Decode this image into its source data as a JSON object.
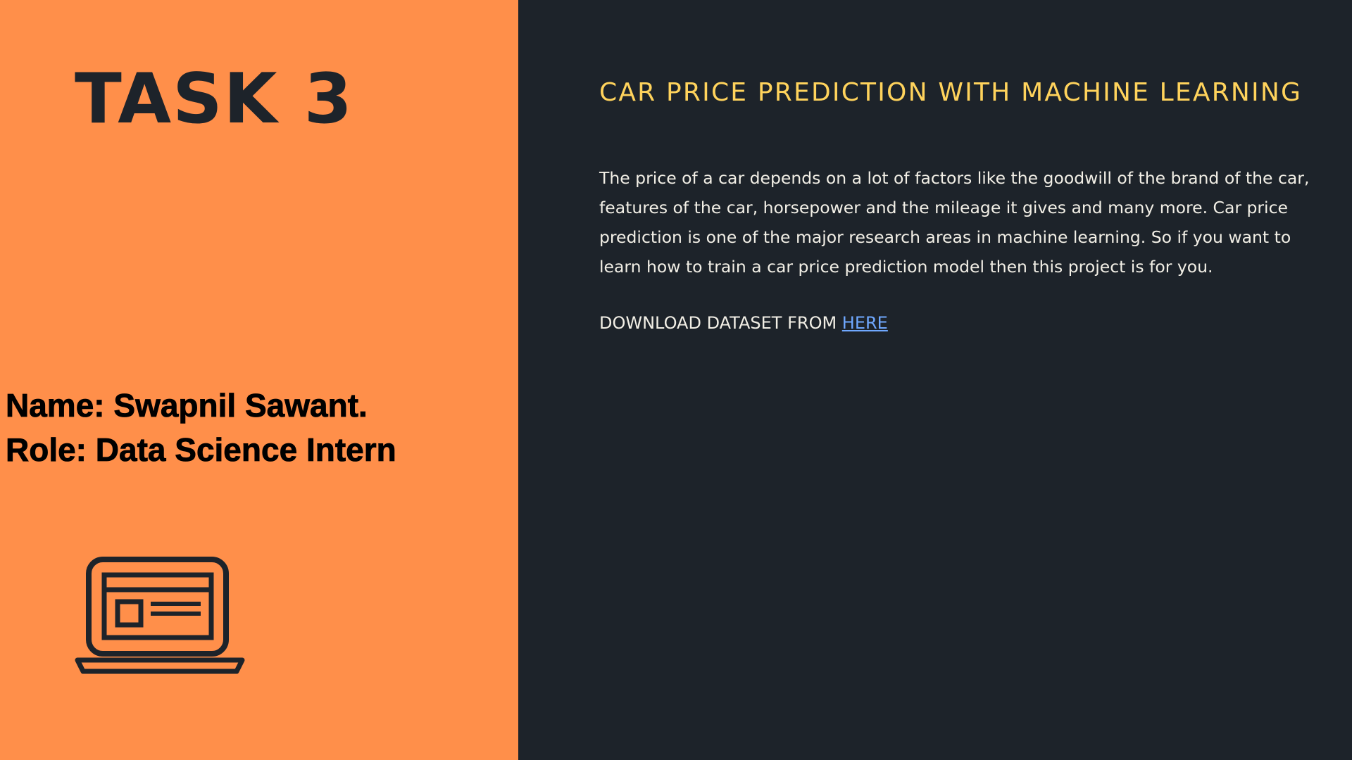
{
  "left_panel": {
    "task_title": "TASK 3",
    "name_line": "Name: Swapnil Sawant.",
    "role_line": "Role: Data Science Intern",
    "icon": "laptop-icon"
  },
  "right_panel": {
    "title": "CAR PRICE PREDICTION WITH MACHINE LEARNING",
    "description": "The price of a car depends on a lot of factors like the goodwill of the brand of the car, features of the car, horsepower and the mileage it gives and many more. Car price prediction is one of the major research areas in machine learning. So if you want to learn how to train a car price prediction model then this project is for you.",
    "download_prefix": "DOWNLOAD DATASET FROM ",
    "download_link_label": "HERE"
  },
  "colors": {
    "left_background": "#ff8f4a",
    "right_background": "#1d232a",
    "title_accent": "#ffd35c",
    "body_text": "#f2efe6",
    "link": "#6fa8ff",
    "dark_text": "#1d232a"
  }
}
